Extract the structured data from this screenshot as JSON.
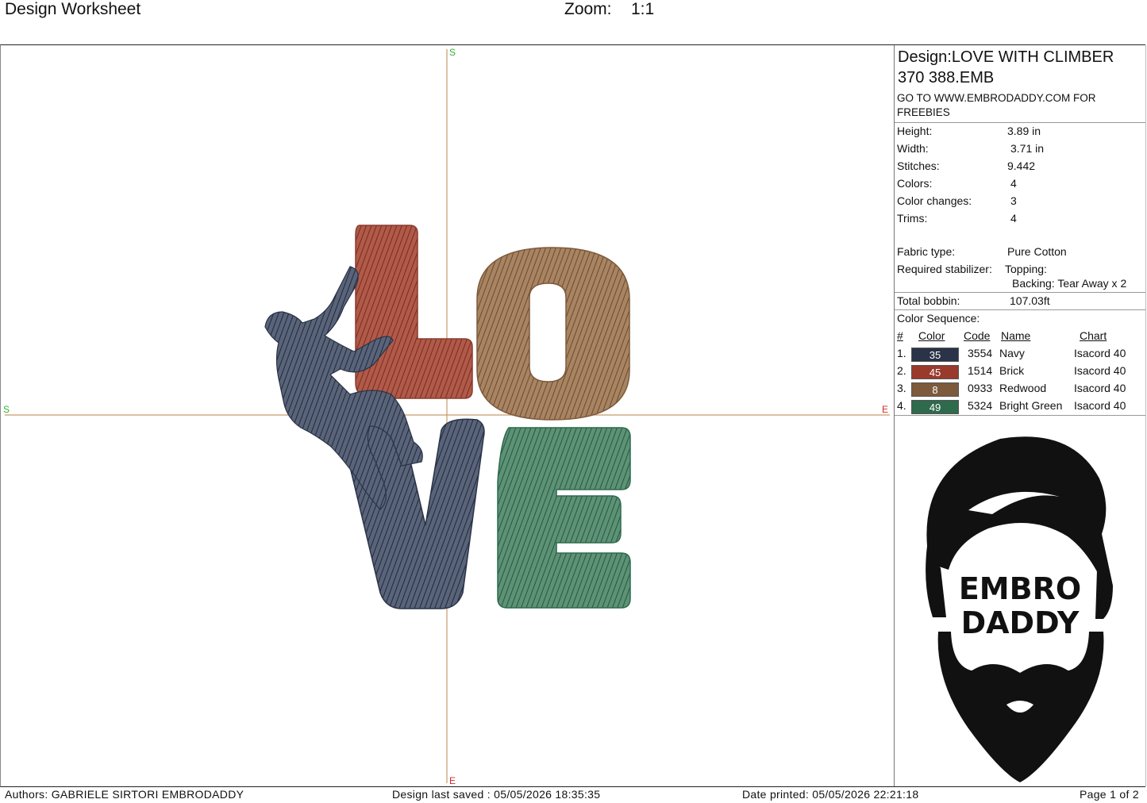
{
  "header": {
    "title": "Design Worksheet",
    "zoom_label": "Zoom:",
    "zoom_value": "1:1"
  },
  "canvas": {
    "markers": {
      "start_top": "S",
      "start_left": "S",
      "end_right": "E",
      "end_bottom": "E"
    },
    "letters": [
      "L",
      "O",
      "V",
      "E"
    ]
  },
  "design": {
    "name": "Design:LOVE WITH CLIMBER 370 388.EMB",
    "promo": "GO TO WWW.EMBRODADDY.COM FOR FREEBIES"
  },
  "stats": [
    {
      "label": "Height:",
      "value": "3.89 in"
    },
    {
      "label": "Width:",
      "value": "3.71 in"
    },
    {
      "label": "Stitches:",
      "value": "9.442"
    },
    {
      "label": "Colors:",
      "value": "4"
    },
    {
      "label": "Color changes:",
      "value": "3"
    },
    {
      "label": "Trims:",
      "value": "4"
    }
  ],
  "fabric": {
    "fabric_label": "Fabric type:",
    "fabric_value": "Pure Cotton",
    "stabilizer_label": "Required stabilizer:",
    "topping": "Topping:",
    "backing": "Backing: Tear Away x 2",
    "bobbin_label": "Total bobbin:",
    "bobbin_value": "107.03ft"
  },
  "color_sequence": {
    "label": "Color Sequence:",
    "headers": {
      "num": "#",
      "color": "Color",
      "code": "Code",
      "name": "Name",
      "chart": "Chart"
    },
    "rows": [
      {
        "num": "1.",
        "color": "35",
        "hex": "#2a3347",
        "code": "3554",
        "name": "Navy",
        "chart": "Isacord 40"
      },
      {
        "num": "2.",
        "color": "45",
        "hex": "#9a3a2c",
        "code": "1514",
        "name": "Brick",
        "chart": "Isacord 40"
      },
      {
        "num": "3.",
        "color": "8",
        "hex": "#7d5a3c",
        "code": "0933",
        "name": "Redwood",
        "chart": "Isacord 40"
      },
      {
        "num": "4.",
        "color": "49",
        "hex": "#2e6a4c",
        "code": "5324",
        "name": "Bright Green",
        "chart": "Isacord 40"
      }
    ]
  },
  "logo": {
    "line1": "EMBRO",
    "line2": "DADDY"
  },
  "footer": {
    "authors": "Authors: GABRIELE SIRTORI EMBRODADDY",
    "last_saved": "Design last saved : 05/05/2026 18:35:35",
    "date_printed": "Date printed: 05/05/2026 22:21:18",
    "page": "Page 1 of 2"
  },
  "colors": {
    "axis": "#c79a6a",
    "start_marker": "#2db52d",
    "end_marker": "#d02a2a"
  }
}
